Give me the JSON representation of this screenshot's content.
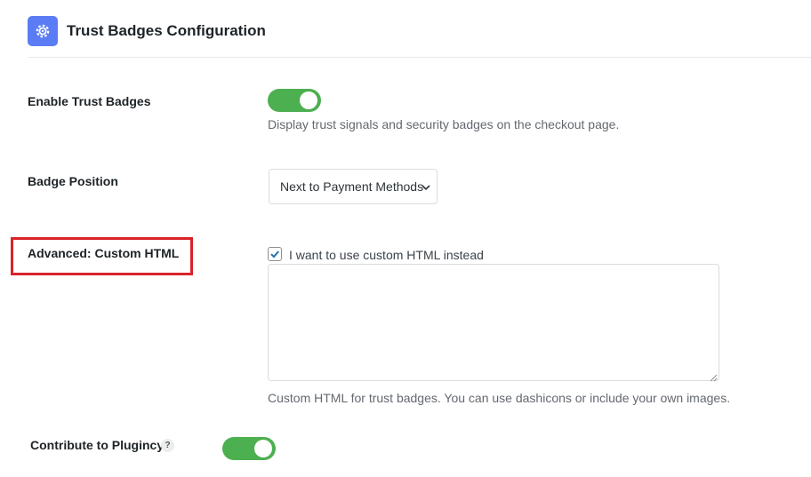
{
  "header": {
    "title": "Trust Badges Configuration",
    "icon": "settings-gear-icon",
    "icon_color": "#5b7cf5"
  },
  "settings": {
    "enable_trust_badges": {
      "label": "Enable Trust Badges",
      "enabled": true,
      "description": "Display trust signals and security badges on the checkout page."
    },
    "badge_position": {
      "label": "Badge Position",
      "selected": "Next to Payment Methods"
    },
    "custom_html": {
      "label": "Advanced: Custom HTML",
      "checkbox_label": "I want to use custom HTML instead",
      "checked": true,
      "textarea_value": "",
      "description": "Custom HTML for trust badges. You can use dashicons or include your own images."
    },
    "contribute": {
      "label": "Contribute to Plugincy",
      "help": "?",
      "enabled": true
    }
  },
  "colors": {
    "toggle_on": "#4caf50",
    "highlight_border": "#d9232a",
    "checkbox_check": "#2271b1"
  }
}
